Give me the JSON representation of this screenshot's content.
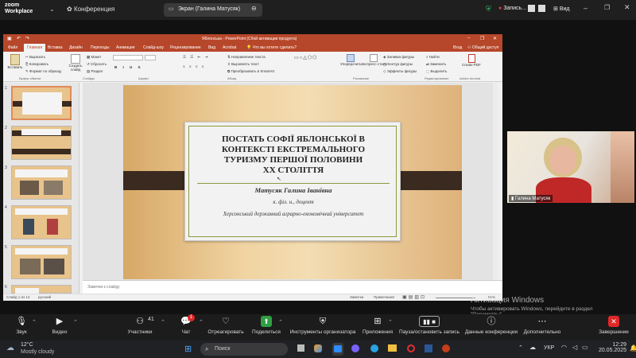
{
  "zoom": {
    "brand_line1": "zoom",
    "brand_line2": "Workplace",
    "conference_label": "Конференция",
    "screen_share_label": "Экран (Галина Матусяк)",
    "recording_label": "Запись...",
    "view_label": "Вид"
  },
  "ppt": {
    "window_title": "Яблонська - PowerPoint (Сбой активации продукта)",
    "tabs": [
      "Файл",
      "Главная",
      "Вставка",
      "Дизайн",
      "Переходы",
      "Анимация",
      "Слайд-шоу",
      "Рецензирование",
      "Вид",
      "Acrobat",
      "Что вы хотите сделать?",
      "Вход",
      "Общий доступ"
    ],
    "ribbon": {
      "paste": "Вставить",
      "cut": "Вырезать",
      "copy": "Копировать",
      "format_painter": "Формат по образцу",
      "new_slide": "Создать слайд",
      "layout": "Макет",
      "reset": "Сбросить",
      "section": "Раздел",
      "text_direction": "Направление текста",
      "align_text": "Выровнять текст",
      "convert_smartart": "Преобразовать в SmartArt",
      "arrange": "Упорядочить",
      "quick_styles": "Экспресс-стили",
      "shape_fill": "Заливка фигуры",
      "shape_outline": "Контур фигуры",
      "shape_effects": "Эффекты фигуры",
      "find": "Найти",
      "replace": "Заменить",
      "select": "Выделить",
      "create_pdf": "Create PDF",
      "groups": [
        "Буфер обмена",
        "Слайды",
        "Шрифт",
        "Абзац",
        "Рисование",
        "Редактирование",
        "Adobe Acrobat"
      ]
    },
    "thumb_numbers": [
      "1",
      "2",
      "3",
      "4",
      "5",
      "6"
    ],
    "notes_placeholder": "Заметки к слайду",
    "status_left": "Слайд 1 из 14",
    "status_lang": "русский",
    "status_notes": "Заметки",
    "status_comments": "Примечания",
    "zoom_level": "61%"
  },
  "slide": {
    "title_lines": [
      "ПОСТАТЬ СОФІЇ ЯБЛОНСЬКОЇ В",
      "КОНТЕКСТІ ЕКСТРЕМАЛЬНОГО",
      "ТУРИЗМУ ПЕРШОЇ ПОЛОВИНИ",
      "ХХ СТОЛІТТЯ"
    ],
    "author": "Матусяк Галина Іванівна",
    "degree": "к. філ. н., доцент",
    "institution": "Херсонський державний аграрно-економічний університет"
  },
  "video": {
    "participant_name": "Галина Матусяк"
  },
  "watermark": {
    "line1": "Активация Windows",
    "line2": "Чтобы активировать Windows, перейдите в раздел",
    "line3": "\"Параметры\"."
  },
  "toolbar": {
    "items": [
      {
        "label": "Звук",
        "icon": "microphone-icon"
      },
      {
        "label": "Видео",
        "icon": "camera-icon"
      },
      {
        "label": "Участники",
        "icon": "participants-icon",
        "count": "41"
      },
      {
        "label": "Чат",
        "icon": "chat-icon",
        "badge": "1"
      },
      {
        "label": "Отреагировать",
        "icon": "heart-icon"
      },
      {
        "label": "Поделиться",
        "icon": "share-icon"
      },
      {
        "label": "Инструменты организатора",
        "icon": "shield-icon"
      },
      {
        "label": "Приложения",
        "icon": "apps-icon"
      },
      {
        "label": "Пауза/остановить запись",
        "icon": "pause-icon"
      },
      {
        "label": "Данные конференции",
        "icon": "info-icon"
      },
      {
        "label": "Дополнительно",
        "icon": "more-icon"
      },
      {
        "label": "Завершение",
        "icon": "close-icon"
      }
    ]
  },
  "taskbar": {
    "weather_temp": "12°C",
    "weather_desc": "Mostly cloudy",
    "search_placeholder": "Поиск",
    "language": "УКР",
    "time": "12:29",
    "date": "20.05.2025"
  },
  "colors": {
    "ppt_accent": "#b7472a",
    "zoom_end": "#e02828",
    "slide_band": "#3a2a20",
    "slide_rule": "#8a9a3e"
  }
}
